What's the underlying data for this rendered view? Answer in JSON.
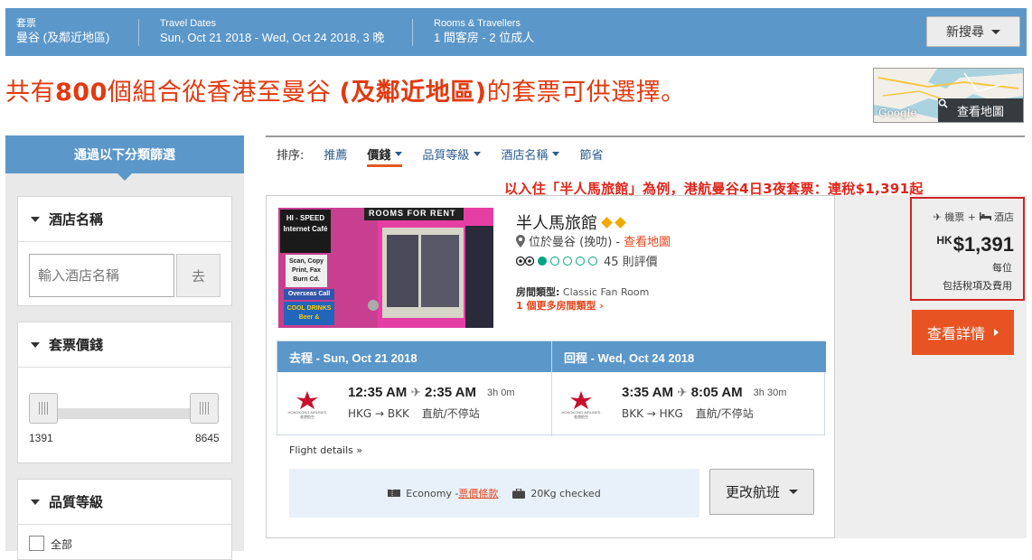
{
  "topbar": {
    "package_label": "套票",
    "package_value": "曼谷 (及鄰近地區)",
    "dates_label": "Travel Dates",
    "dates_value": "Sun, Oct 21 2018 - Wed, Oct 24 2018, 3 晚",
    "rooms_label": "Rooms & Travellers",
    "rooms_value": "1 間客房 - 2 位成人",
    "new_search_label": "新搜尋"
  },
  "headline": {
    "prefix": "共有",
    "count": "800",
    "mid": "個組合從香港至曼谷 ",
    "bold_part": "(及鄰近地區)",
    "suffix": "的套票可供選擇。"
  },
  "map": {
    "provider_text": "Google",
    "button_label": "查看地圖",
    "icon": "search-icon"
  },
  "sidebar": {
    "title": "通過以下分類篩選",
    "hotel_filter": {
      "title": "酒店名稱",
      "placeholder": "輸入酒店名稱",
      "go_label": "去"
    },
    "price_filter": {
      "title": "套票價錢",
      "min": "1391",
      "max": "8645"
    },
    "quality_filter": {
      "title": "品質等級",
      "first_option": "全部"
    }
  },
  "sort": {
    "label": "排序:",
    "items": [
      {
        "label": "推薦",
        "dropdown": false,
        "active": false
      },
      {
        "label": "價錢",
        "dropdown": true,
        "active": true
      },
      {
        "label": "品質等級",
        "dropdown": true,
        "active": false
      },
      {
        "label": "酒店名稱",
        "dropdown": true,
        "active": false
      },
      {
        "label": "節省",
        "dropdown": false,
        "active": false
      }
    ]
  },
  "promo_text": "以入住「半人馬旅館」為例，港航曼谷4日3夜套票：連稅$1,391起",
  "result": {
    "hotel_name": "半人馬旅館",
    "location_text": "位於曼谷 (挽叻) - ",
    "map_link": "查看地圖",
    "reviews": "45 則評價",
    "room_type_label": "房間類型:",
    "room_type_value": "Classic Fan Room",
    "more_rooms": "1 個更多房間類型",
    "image_signs": {
      "top_banner": "ROOMS FOR RENT",
      "sign1": "HI - SPEED Internet Café",
      "sign2": "Scan, Copy Print, Fax Burn Cd.",
      "sign3": "Overseas Call",
      "sign4": "COOL DRINKS Beer &"
    },
    "outbound": {
      "header": "去程 - Sun, Oct 21 2018",
      "depart": "12:35 AM",
      "arrive": "2:35 AM",
      "duration": "3h 0m",
      "route": "HKG → BKK",
      "stops": "直航/不停站"
    },
    "inbound": {
      "header": "回程 - Wed, Oct 24 2018",
      "depart": "3:35 AM",
      "arrive": "8:05 AM",
      "duration": "3h 30m",
      "route": "BKK → HKG",
      "stops": "直航/不停站"
    },
    "airline_name_en": "HONGKONG AIRLINES",
    "airline_name_zh": "香港航空",
    "flight_details": "Flight details",
    "fare_class": "Economy - ",
    "fare_rules": "票價條款",
    "baggage": "20Kg checked",
    "change_flight": "更改航班",
    "price": {
      "type_flight": "機票",
      "type_hotel": "酒店",
      "currency": "HK",
      "amount": "$1,391",
      "per": "每位",
      "tax_note": "包括稅項及費用"
    },
    "detail_button": "查看詳情"
  },
  "colors": {
    "brand_blue": "#5b97c9",
    "headline_red": "#e23a10",
    "cta_orange": "#e85323",
    "highlight_red": "#d32424",
    "tripadvisor_green": "#00a680",
    "star_gold": "#f2a900"
  }
}
